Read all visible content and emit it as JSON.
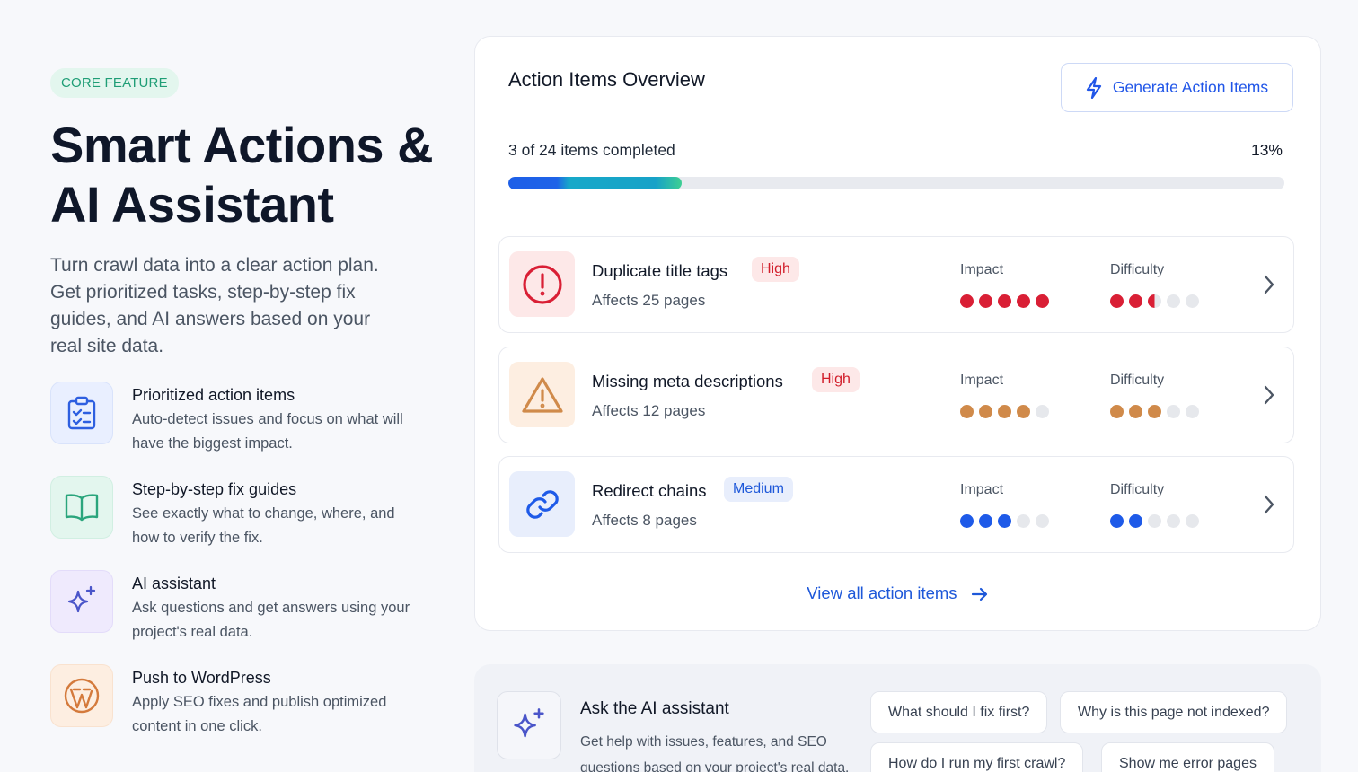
{
  "hero": {
    "badge": "CORE FEATURE",
    "title_line1": "Smart Actions &",
    "title_line2": "AI Assistant",
    "description": "Turn crawl data into a clear action plan. Get prioritized tasks, step-by-step fix guides, and AI answers based on your real site data."
  },
  "features": [
    {
      "icon": "clipboard-check-icon",
      "title": "Prioritized action items",
      "description": "Auto-detect issues and focus on what will have the biggest impact."
    },
    {
      "icon": "book-open-icon",
      "title": "Step-by-step fix guides",
      "description": "See exactly what to change, where, and how to verify the fix."
    },
    {
      "icon": "sparkles-icon",
      "title": "AI assistant",
      "description": "Ask questions and get answers using your project's real data."
    },
    {
      "icon": "wordpress-icon",
      "title": "Push to WordPress",
      "description": "Apply SEO fixes and publish optimized content in one click."
    }
  ],
  "overview": {
    "title": "Action Items Overview",
    "generate_button": "Generate Action Items",
    "progress_text": "3 of 24 items completed",
    "progress_percent_label": "13%",
    "progress_fraction": 0.223,
    "impact_label": "Impact",
    "difficulty_label": "Difficulty",
    "items": [
      {
        "title": "Duplicate title tags",
        "severity": "High",
        "affects": "Affects 25 pages",
        "impact": 5,
        "difficulty": 2.5,
        "color": "#d91f35",
        "icon": "alert-circle-icon"
      },
      {
        "title": "Missing meta descriptions",
        "severity": "High",
        "affects": "Affects 12 pages",
        "impact": 4,
        "difficulty": 3,
        "color": "#d08a4a",
        "icon": "warning-triangle-icon"
      },
      {
        "title": "Redirect chains",
        "severity": "Medium",
        "affects": "Affects 8 pages",
        "impact": 3,
        "difficulty": 2,
        "color": "#1e5ae8",
        "icon": "link-icon"
      }
    ],
    "view_all": "View all action items"
  },
  "ai": {
    "title": "Ask the AI assistant",
    "description": "Get help with issues, features, and SEO questions based on your project's real data.",
    "chips": [
      "What should I fix first?",
      "Why is this page not indexed?",
      "How do I run my first crawl?",
      "Show me error pages"
    ]
  }
}
